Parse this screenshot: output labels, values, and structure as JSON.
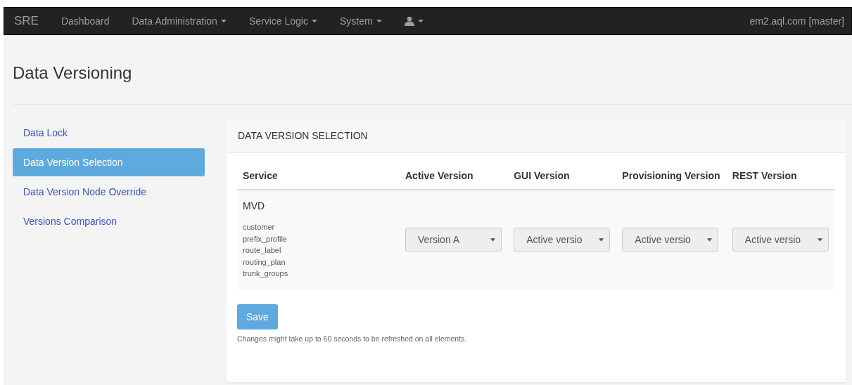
{
  "navbar": {
    "brand": "SRE",
    "items": [
      {
        "label": "Dashboard",
        "kind": "link"
      },
      {
        "label": "Data Administration",
        "kind": "dropdown"
      },
      {
        "label": "Service Logic",
        "kind": "dropdown"
      },
      {
        "label": "System",
        "kind": "dropdown"
      },
      {
        "kind": "user-dropdown"
      }
    ],
    "server": "em2.aql.com [master]"
  },
  "page_title": "Data Versioning",
  "sidebar": {
    "items": [
      {
        "label": "Data Lock",
        "selected": false
      },
      {
        "label": "Data Version Selection",
        "selected": true
      },
      {
        "label": "Data Version Node Override",
        "selected": false
      },
      {
        "label": "Versions Comparison",
        "selected": false
      }
    ]
  },
  "panel": {
    "title": "DATA VERSION SELECTION",
    "table": {
      "columns": [
        "Service",
        "Active Version",
        "GUI Version",
        "Provisioning Version",
        "REST Version"
      ],
      "rows": [
        {
          "service": "MVD",
          "tables": [
            "customer",
            "prefix_profile",
            "route_label",
            "routing_plan",
            "trunk_groups"
          ],
          "selects": [
            "Version A",
            "Active versio",
            "Active versio",
            "Active versio"
          ]
        }
      ]
    },
    "save_button": "Save",
    "note": "Changes might take up to 60 seconds to be refreshed on all elements."
  }
}
